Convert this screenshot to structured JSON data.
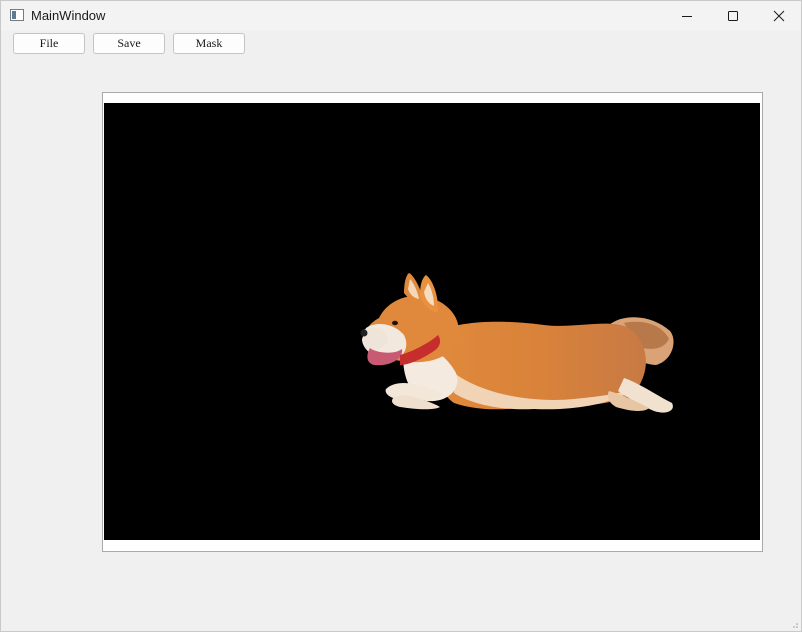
{
  "window": {
    "title": "MainWindow",
    "icon": "app-window-icon",
    "controls": {
      "minimize_icon": "minimize-icon",
      "maximize_icon": "maximize-icon",
      "close_icon": "close-icon"
    }
  },
  "toolbar": {
    "file_label": "File",
    "save_label": "Save",
    "mask_label": "Mask"
  },
  "canvas": {
    "image_subject": "corgi-dog-masked",
    "background_color": "#000000"
  }
}
